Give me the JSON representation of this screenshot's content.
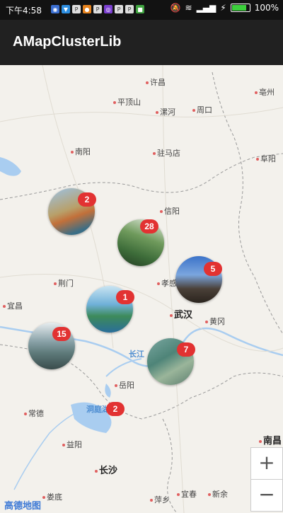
{
  "status_bar": {
    "time": "下午4:58",
    "battery": "100%"
  },
  "app_bar": {
    "title": "AMapClusterLib"
  },
  "map": {
    "cities": [
      {
        "name": "许昌"
      },
      {
        "name": "亳州"
      },
      {
        "name": "平顶山"
      },
      {
        "name": "漯河"
      },
      {
        "name": "周口"
      },
      {
        "name": "南阳"
      },
      {
        "name": "驻马店"
      },
      {
        "name": "阜阳"
      },
      {
        "name": "信阳"
      },
      {
        "name": "荆门"
      },
      {
        "name": "孝感"
      },
      {
        "name": "宜昌"
      },
      {
        "name": "武汉"
      },
      {
        "name": "黄冈"
      },
      {
        "name": "岳阳"
      },
      {
        "name": "常德"
      },
      {
        "name": "益阳"
      },
      {
        "name": "长沙"
      },
      {
        "name": "南昌"
      },
      {
        "name": "娄底"
      },
      {
        "name": "萍乡"
      },
      {
        "name": "宜春"
      },
      {
        "name": "新余"
      }
    ],
    "rivers": [
      {
        "name": "长江"
      },
      {
        "name": "洞庭湖"
      }
    ],
    "clusters": [
      {
        "count": "2"
      },
      {
        "count": "28"
      },
      {
        "count": "5"
      },
      {
        "count": "1"
      },
      {
        "count": "15"
      },
      {
        "count": "7"
      },
      {
        "count": "2"
      }
    ],
    "zoom_in_label": "+",
    "zoom_out_label": "−",
    "logo": "高德地图"
  }
}
